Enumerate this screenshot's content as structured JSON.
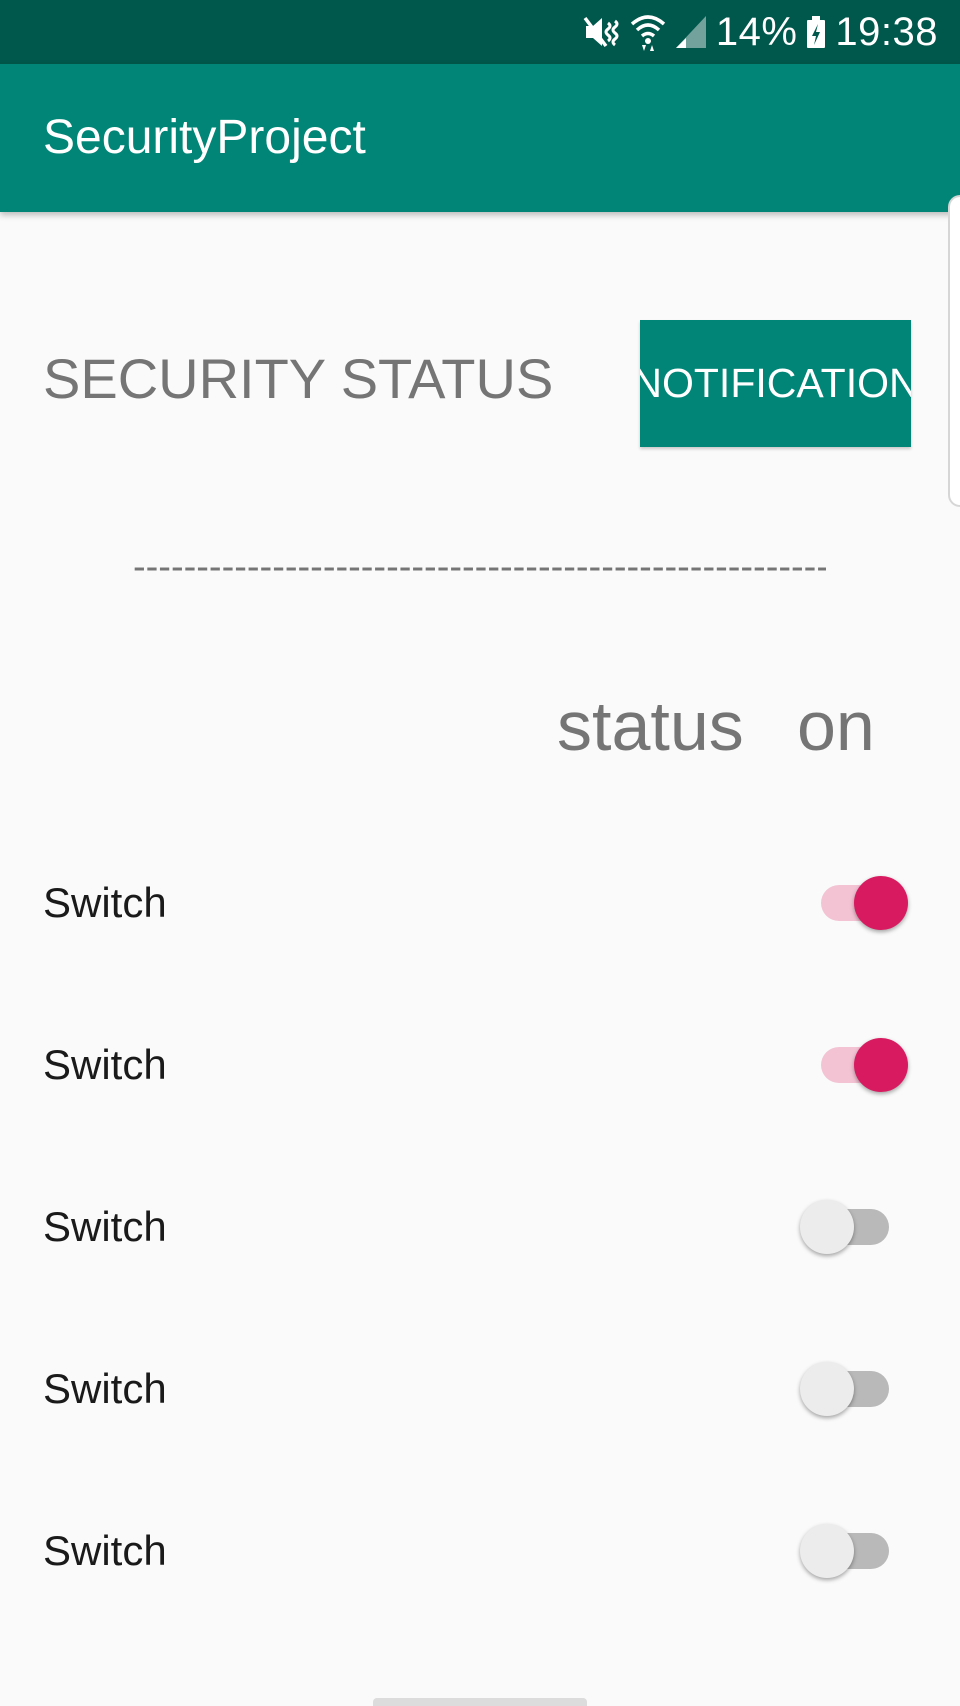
{
  "status_bar": {
    "battery_text": "14%",
    "time": "19:38",
    "icons": [
      "mute-vibrate-icon",
      "wifi-icon",
      "cellular-signal-icon",
      "battery-charging-icon"
    ]
  },
  "app_bar": {
    "title": "SecurityProject"
  },
  "main": {
    "heading": "SECURITY STATUS",
    "notification_button": "NOTIFICATION",
    "separator": "-----------------------------------------------------------",
    "status_label": "status",
    "on_label": "on",
    "switches": [
      {
        "label": "Switch",
        "on": true
      },
      {
        "label": "Switch",
        "on": true
      },
      {
        "label": "Switch",
        "on": false
      },
      {
        "label": "Switch",
        "on": false
      },
      {
        "label": "Switch",
        "on": false
      }
    ]
  },
  "colors": {
    "status_bar": "#00574b",
    "primary": "#008577",
    "accent": "#d81b60",
    "accent_track": "#f3c3d4",
    "text_secondary": "#757575"
  }
}
